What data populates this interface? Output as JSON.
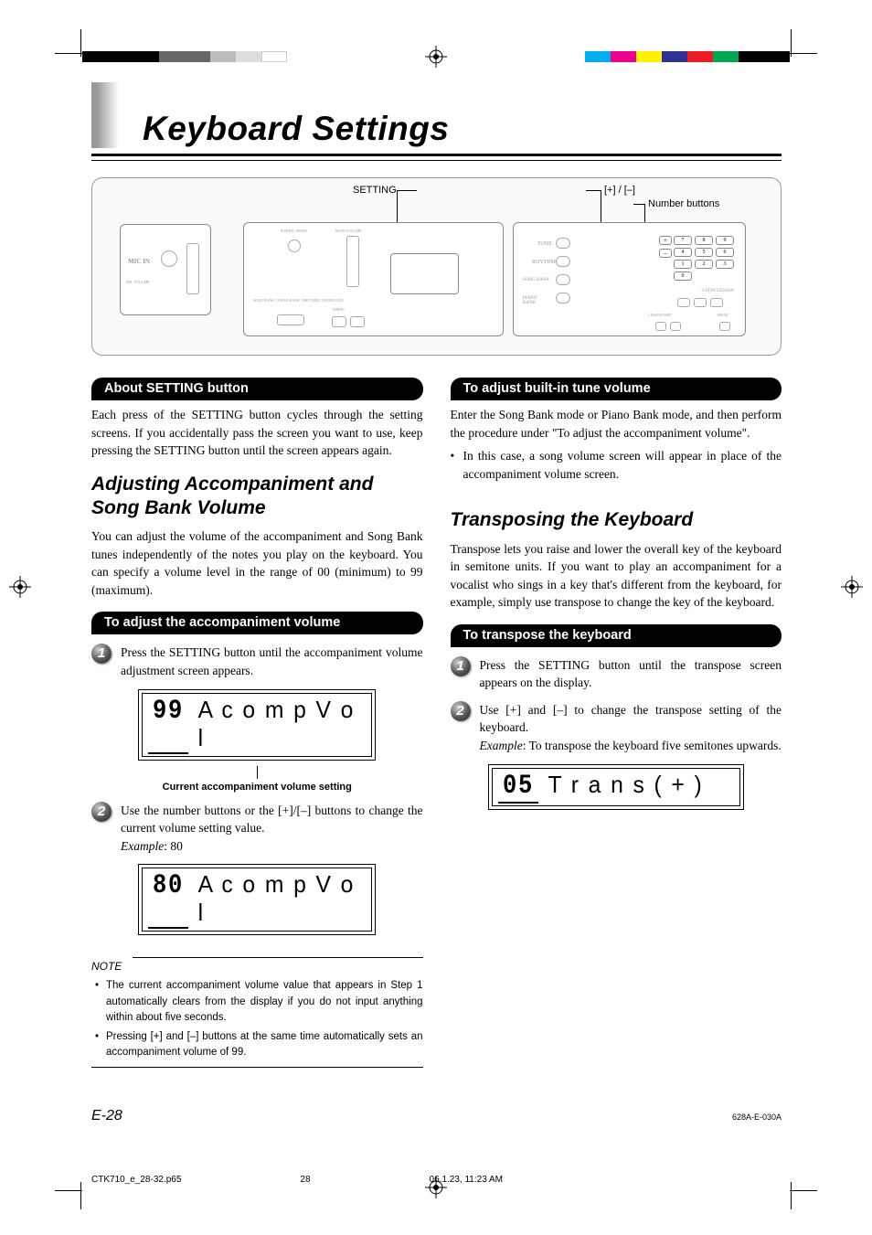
{
  "page": {
    "title": "Keyboard Settings",
    "page_number": "E-28",
    "doc_code": "628A-E-030A",
    "meta_file": "CTK710_e_28-32.p65",
    "meta_page": "28",
    "meta_date": "06.1.23, 11:23 AM"
  },
  "diagram": {
    "label_setting": "SETTING",
    "label_plusminus": "[+] / [–]",
    "label_number_buttons": "Number buttons",
    "tiny": {
      "mic_in": "MIC IN",
      "mic_volume": "MIC VOLUME",
      "power_mode": "POWER / MODE",
      "main_volume": "MAIN VOLUME",
      "song_bank": "SONG BANK / PIANO BANK / RHYTHM CONTROLLER",
      "tempo": "TEMPO",
      "tone": "TONE",
      "rhythm": "RHYTHM",
      "songbank2": "SONG BANK",
      "pianobank": "PIANO BANK",
      "step_lesson": "3-STEP LESSON",
      "lesson_part": "LESSON PART",
      "speak": "SPEAK"
    },
    "keypad": [
      "7",
      "8",
      "9",
      "4",
      "5",
      "6",
      "1",
      "2",
      "3",
      "0",
      "",
      ""
    ],
    "plus": "+",
    "minus": "–"
  },
  "left": {
    "about_heading": "About SETTING button",
    "about_text": "Each press of the SETTING button cycles through the setting screens. If you accidentally pass the screen you want to use, keep pressing the SETTING button until the screen appears again.",
    "adjust_heading": "Adjusting Accompaniment and Song Bank Volume",
    "adjust_text": "You can adjust the volume of the accompaniment and Song Bank tunes independently of the notes you play on the keyboard. You can specify a volume level in the range of 00 (minimum) to 99 (maximum).",
    "to_adjust_heading": "To adjust the accompaniment volume",
    "step1": "Press the SETTING button until the accompaniment volume adjustment screen appears.",
    "lcd1_num": "99",
    "lcd1_label": "A c o m p V o l",
    "lcd1_caption": "Current accompaniment volume setting",
    "step2_a": "Use the number buttons or the [+]/[–] buttons to change the current volume setting value.",
    "step2_example_label": "Example",
    "step2_example_val": ": 80",
    "lcd2_num": "80",
    "lcd2_label": "A c o m p V o l",
    "note_label": "NOTE",
    "notes": [
      "The current accompaniment volume value that appears in Step 1 automatically clears from the display if you do not input anything within about five seconds.",
      "Pressing [+] and [–] buttons at the same time automatically sets an accompaniment volume of 99."
    ]
  },
  "right": {
    "builtin_heading": "To adjust built-in tune volume",
    "builtin_text": "Enter the Song Bank mode or Piano Bank mode, and then perform the procedure under \"To adjust the accompaniment volume\".",
    "builtin_bullet": "In this case, a song volume screen will appear in place of the accompaniment volume screen.",
    "transpose_heading": "Transposing the Keyboard",
    "transpose_text": "Transpose lets you raise and lower the overall key of the keyboard in semitone units. If you want to play an accompaniment for a vocalist who sings in a key that's different from the keyboard, for example, simply use transpose to change the key of the keyboard.",
    "to_transpose_heading": "To transpose the keyboard",
    "t_step1": "Press the SETTING button until the transpose screen appears on the display.",
    "t_step2": "Use [+] and [–] to change the transpose setting of the keyboard.",
    "t_example_label": "Example",
    "t_example_val": ": To transpose the keyboard five semitones upwards.",
    "lcd3_num": "05",
    "lcd3_label": "T r a n s ( + )"
  }
}
